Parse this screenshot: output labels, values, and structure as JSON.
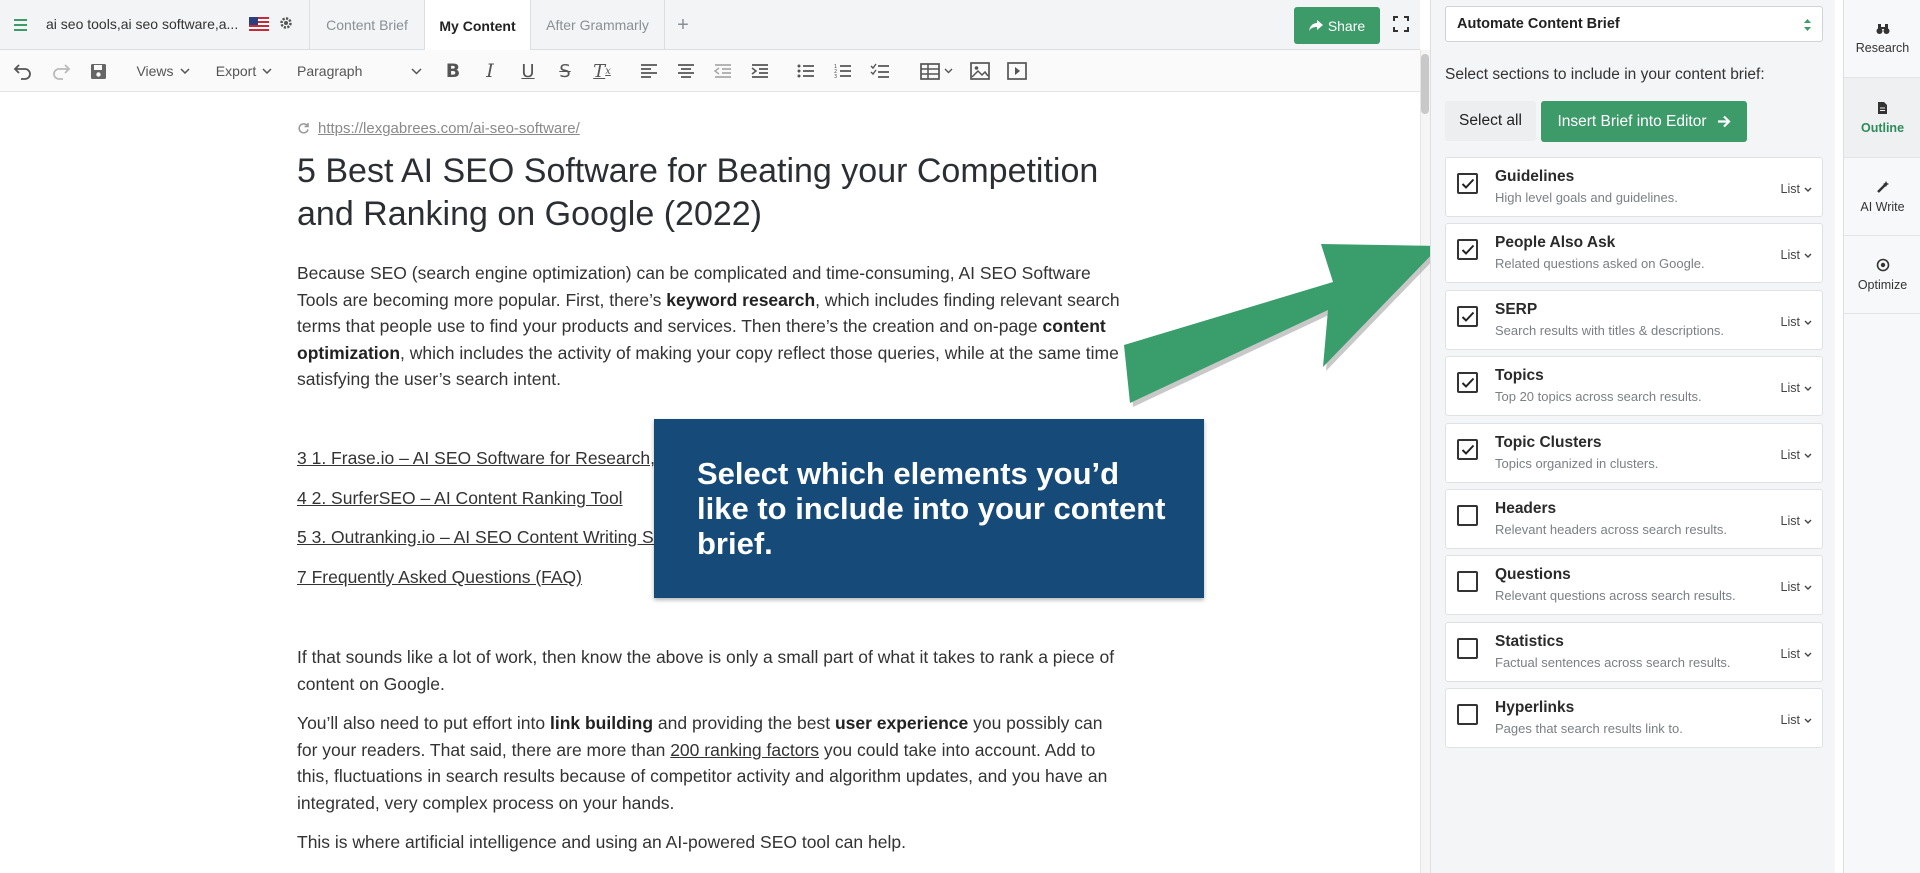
{
  "header": {
    "doc_title": "ai seo tools,ai seo software,a...",
    "tabs": [
      {
        "label": "Content Brief"
      },
      {
        "label": "My Content"
      },
      {
        "label": "After Grammarly"
      }
    ],
    "share_label": "Share"
  },
  "toolbar": {
    "views_label": "Views",
    "export_label": "Export",
    "block_format": "Paragraph"
  },
  "document": {
    "source_url": "https://lexgabrees.com/ai-seo-software/",
    "heading": "5 Best AI SEO Software for  Beating your Competition and Ranking on Google (2022)",
    "p1": {
      "a": "Because SEO (search engine optimization) can be complicated and time-consuming, AI SEO Software Tools are becoming more popular. First, there’s ",
      "b1": "keyword research",
      "c": ", which includes finding relevant search terms that people use to find your products and services. Then there’s the creation and on-page ",
      "b2": "content optimization",
      "d": ", which includes the activity of making your copy reflect those queries, while at the same time satisfying the user’s search intent."
    },
    "toc": [
      "3 1. Frase.io – AI SEO Software for Research, C",
      "4 2. SurferSEO – AI Content Ranking Tool",
      "5 3. Outranking.io – AI SEO Content Writing So",
      "7 Frequently Asked Questions (FAQ)"
    ],
    "p2": "If that sounds like a lot of work, then know the above is only a small part of what it takes to rank a piece of content on Google.",
    "p3": {
      "a": "You’ll also need to put effort into ",
      "b1": "link building",
      "c": " and providing the best ",
      "b2": "user experience",
      "d": " you possibly can for your readers. That said, there are more than ",
      "link": "200 ranking factors",
      "e": " you could take into account. Add to this, fluctuations in search results because of competitor activity and algorithm updates, and you have an integrated, very complex process on your hands."
    },
    "p4": "This is where artificial intelligence and using an AI-powered SEO tool can help."
  },
  "callout": {
    "text": "Select which elements you’d like to include into your content brief."
  },
  "panel": {
    "mode_select": "Automate Content Brief",
    "hint": "Select sections to include in your content brief:",
    "select_all_label": "Select all",
    "insert_label": "Insert Brief into Editor",
    "sections": [
      {
        "title": "Guidelines",
        "desc": "High level goals and guidelines.",
        "mode": "List",
        "checked": true
      },
      {
        "title": "People Also Ask",
        "desc": "Related questions asked on Google.",
        "mode": "List",
        "checked": true
      },
      {
        "title": "SERP",
        "desc": "Search results with titles & descriptions.",
        "mode": "List",
        "checked": true
      },
      {
        "title": "Topics",
        "desc": "Top 20 topics across search results.",
        "mode": "List",
        "checked": true
      },
      {
        "title": "Topic Clusters",
        "desc": "Topics organized in clusters.",
        "mode": "List",
        "checked": true
      },
      {
        "title": "Headers",
        "desc": "Relevant headers across search results.",
        "mode": "List",
        "checked": false
      },
      {
        "title": "Questions",
        "desc": "Relevant questions across search results.",
        "mode": "List",
        "checked": false
      },
      {
        "title": "Statistics",
        "desc": "Factual sentences across search results.",
        "mode": "List",
        "checked": false
      },
      {
        "title": "Hyperlinks",
        "desc": "Pages that search results link to.",
        "mode": "List",
        "checked": false
      }
    ]
  },
  "sidenav": {
    "items": [
      {
        "label": "Research",
        "icon": "binoculars-icon"
      },
      {
        "label": "Outline",
        "icon": "document-icon"
      },
      {
        "label": "AI Write",
        "icon": "magic-wand-icon"
      },
      {
        "label": "Optimize",
        "icon": "target-icon"
      }
    ]
  },
  "colors": {
    "accent_green": "#3d9b6a",
    "callout_blue": "#164a78",
    "arrow_green": "#3a9e6c"
  }
}
